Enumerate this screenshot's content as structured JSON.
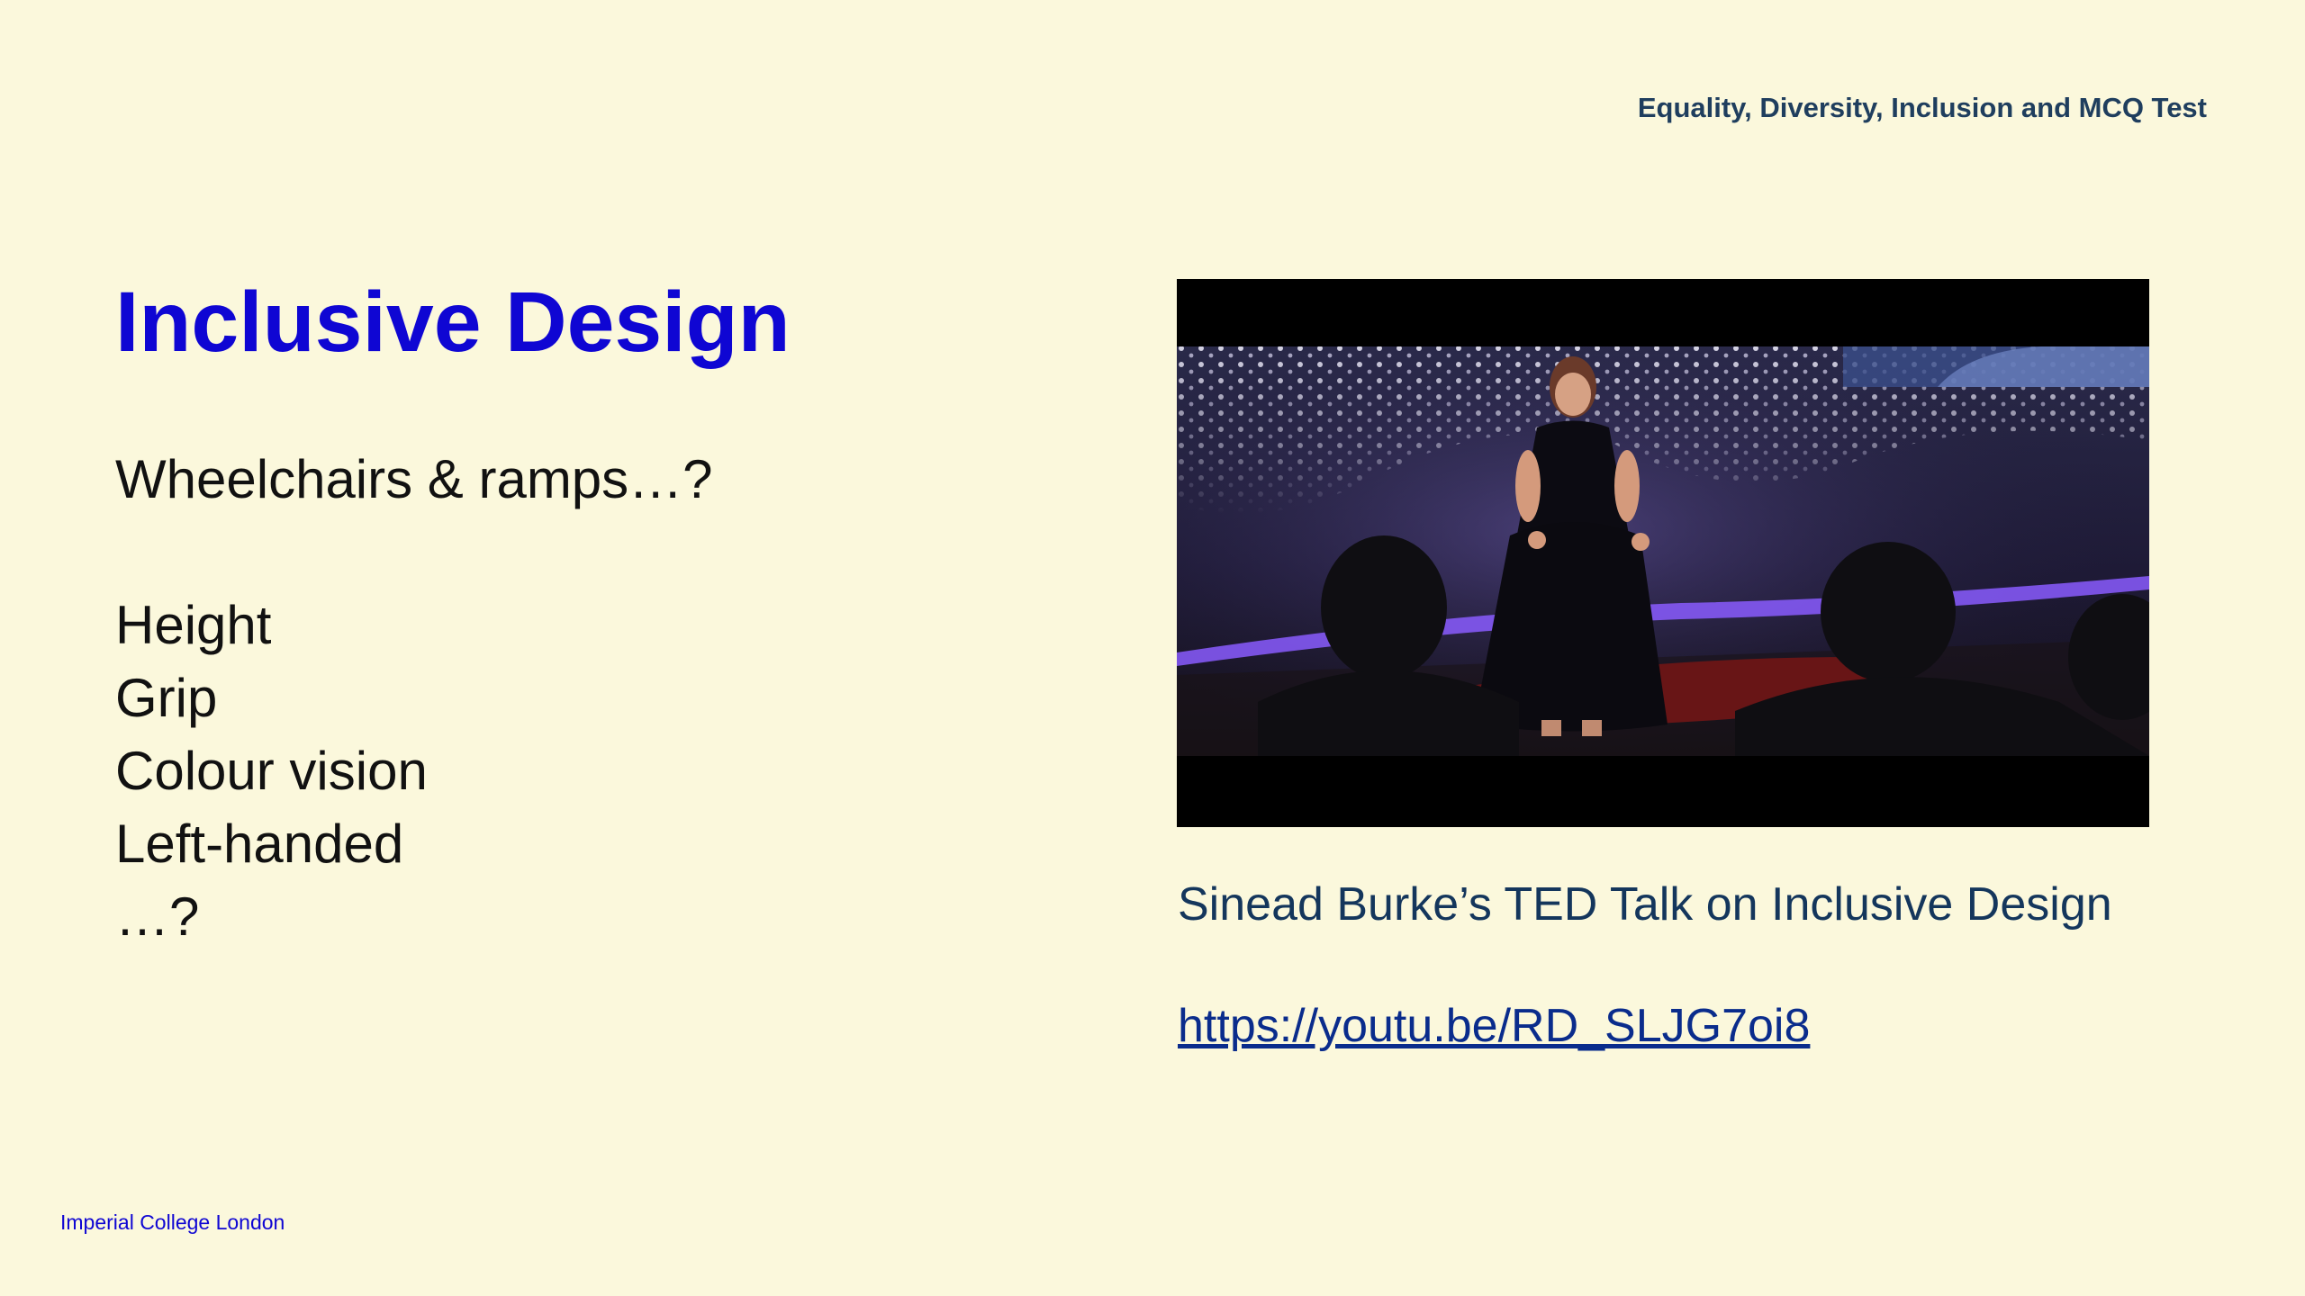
{
  "header": {
    "course": "Equality, Diversity, Inclusion and MCQ Test"
  },
  "slide": {
    "title": "Inclusive Design",
    "question": "Wheelchairs & ramps…?",
    "items": [
      "Height",
      "Grip",
      "Colour vision",
      "Left-handed",
      "…?"
    ]
  },
  "video": {
    "caption": "Sinead Burke’s TED Talk on Inclusive Design",
    "link": "https://youtu.be/RD_SLJG7oi8"
  },
  "footer": {
    "institution": "Imperial College London"
  },
  "colors": {
    "background": "#fbf8dc",
    "title": "#0f06d3",
    "header": "#1f3e5e",
    "link": "#0a2c8c"
  }
}
